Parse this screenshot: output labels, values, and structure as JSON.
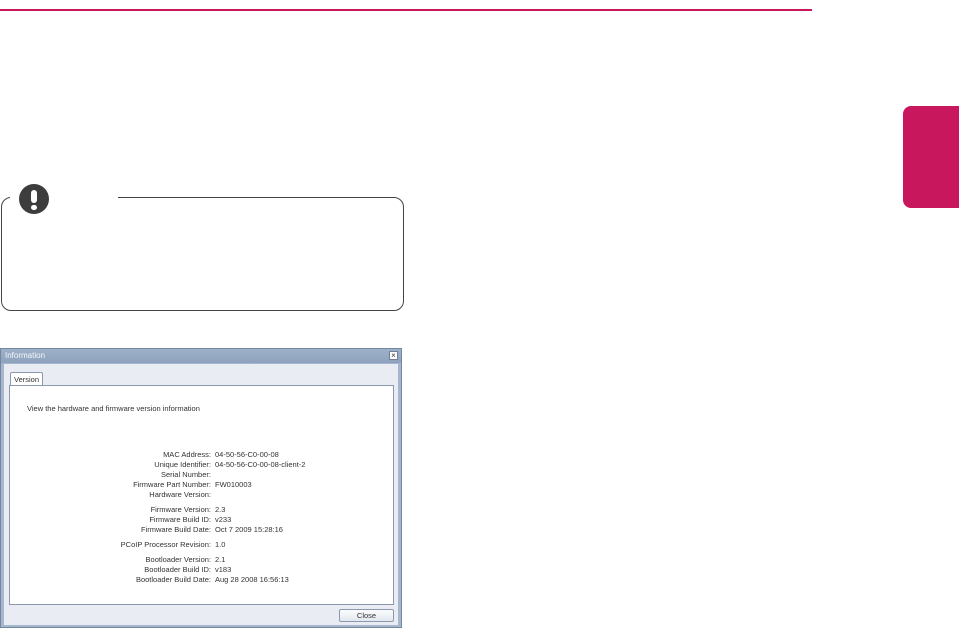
{
  "window": {
    "title": "Information",
    "close_glyph": "×"
  },
  "tabs": [
    {
      "label": "Version"
    }
  ],
  "intro": "View the hardware and firmware version information",
  "fields": [
    {
      "label": "MAC Address:",
      "value": "04-50-56-C0-00-08"
    },
    {
      "label": "Unique Identifier:",
      "value": "04-50-56-C0-00-08-client-2"
    },
    {
      "label": "Serial Number:",
      "value": ""
    },
    {
      "label": "Firmware Part Number:",
      "value": "FW010003"
    },
    {
      "label": "Hardware Version:",
      "value": ""
    },
    {
      "label": "Firmware Version:",
      "value": "2.3"
    },
    {
      "label": "Firmware Build ID:",
      "value": "v233"
    },
    {
      "label": "Firmware Build Date:",
      "value": "Oct  7 2009 15:28:16"
    },
    {
      "label": "PCoIP Processor Revision:",
      "value": "1.0"
    },
    {
      "label": "Bootloader Version:",
      "value": "2.1"
    },
    {
      "label": "Bootloader Build ID:",
      "value": "v183"
    },
    {
      "label": "Bootloader Build Date:",
      "value": "Aug 28 2008 16:56:13"
    }
  ],
  "buttons": {
    "close_label": "Close"
  },
  "colors": {
    "accent": "#c8175d",
    "window_frame": "#a6b6cc"
  },
  "icons": {
    "note": "exclamation-icon"
  }
}
